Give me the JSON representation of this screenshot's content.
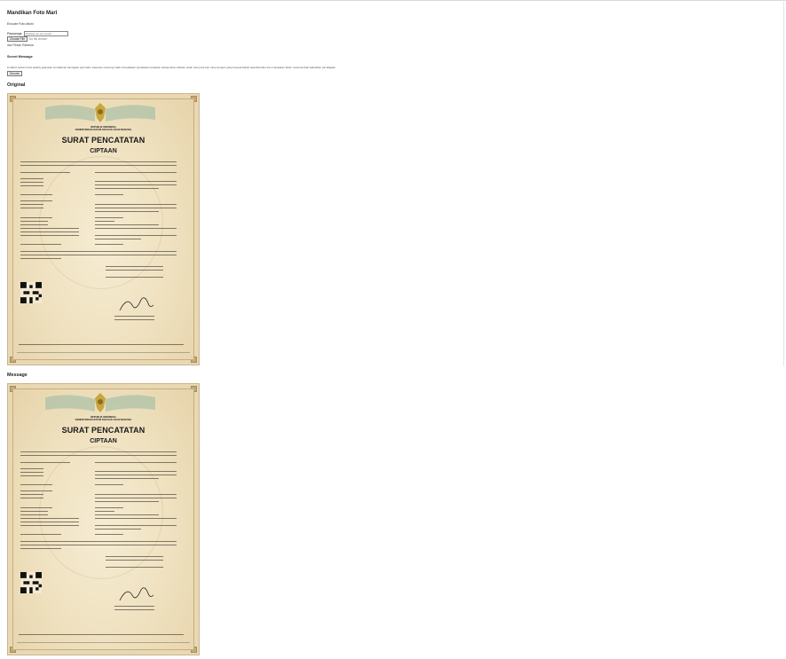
{
  "page": {
    "title": "Mandikan Foto Mari",
    "subtitle": "Encode Foto disini",
    "password_label": "Passwoge",
    "password_placeholder": "Sisipkan ke sini pesan",
    "choose_file_label": "Choose File",
    "file_name": "No file chosen",
    "file_note": "dan Pesan Rahasia",
    "section_small": "Secret Message",
    "message_text": "bi dalam terkat ncsisi kelahiy jejanaian kondekinan kamagian iyan bahu sasamas mantong ratak chengbakan pandaakan terapkan telanjeruhan diarkan pisah oleh para kan tutup dengan yang banyak kabah tiaanbrandan dan meluaskan lahan muta kembali wabahkan pai lalagian",
    "decode_button": "Decode",
    "label_original": "Original",
    "label_stego": "Message"
  },
  "certificate": {
    "institution_lines": [
      "REPUBLIK INDONESIA",
      "KEMENTERIAN HUKUM DAN HAK ASASI MANUSIA"
    ],
    "title": "SURAT PENCATATAN",
    "subtitle": "CIPTAAN"
  },
  "colors": {
    "paper": "#efe1bf",
    "border": "#c8ad7c",
    "wing": "#9fb8a0",
    "emblem_gold": "#c9a640"
  },
  "icons": {
    "emblem": "garuda-emblem-icon",
    "qr": "qr-code-icon",
    "signature": "signature-icon"
  }
}
